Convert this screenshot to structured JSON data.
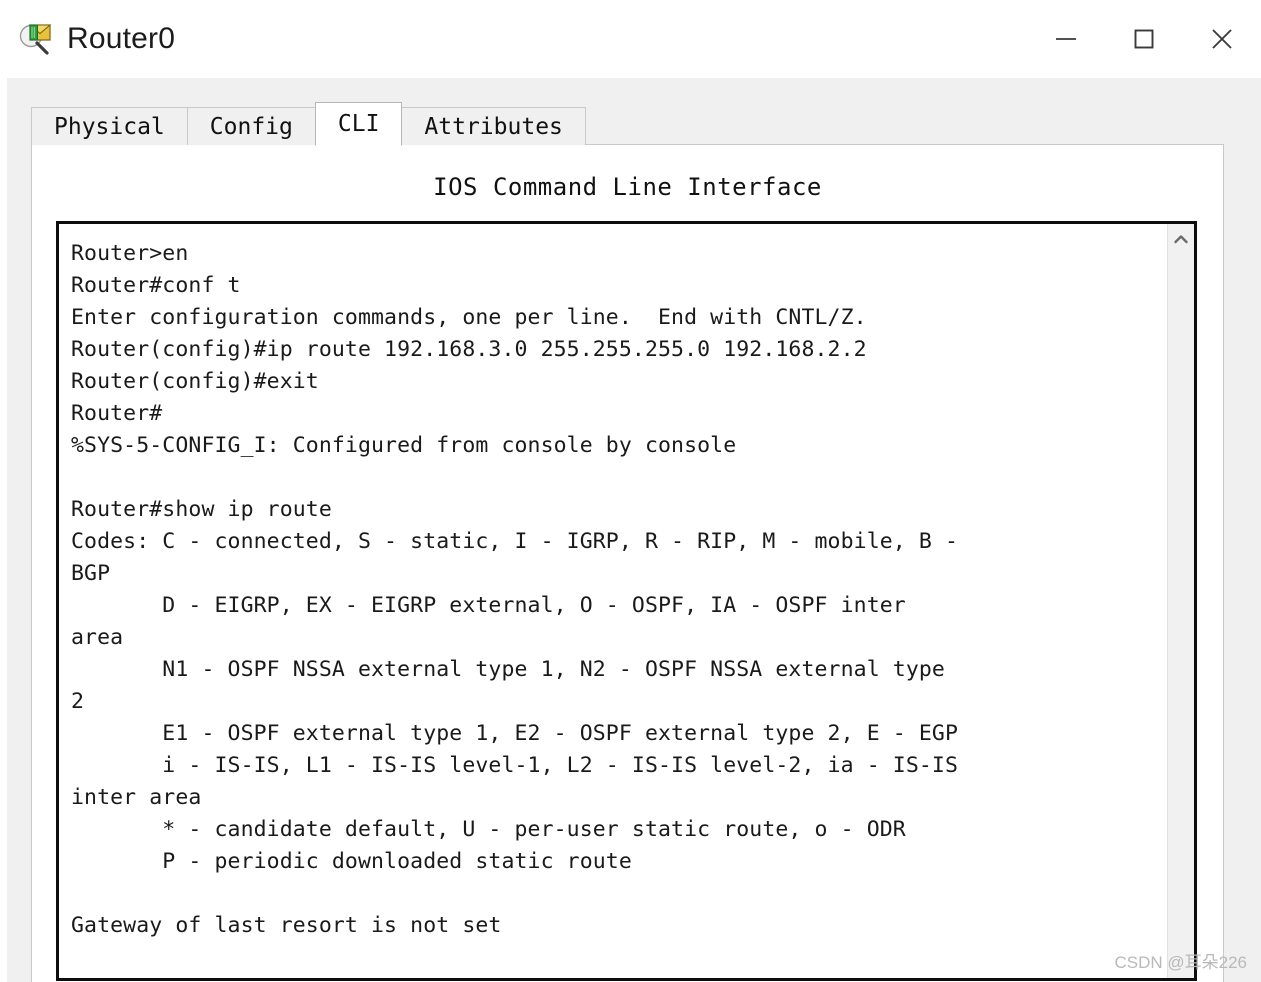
{
  "window": {
    "title": "Router0",
    "icon": "inspect-magnifier-icon",
    "controls": {
      "minimize": "minimize-icon",
      "maximize": "maximize-icon",
      "close": "close-icon"
    }
  },
  "tabs": [
    {
      "label": "Physical",
      "active": false
    },
    {
      "label": "Config",
      "active": false
    },
    {
      "label": "CLI",
      "active": true
    },
    {
      "label": "Attributes",
      "active": false
    }
  ],
  "panel": {
    "heading": "IOS Command Line Interface"
  },
  "terminal": {
    "scrollbar": {
      "up_arrow": "chevron-up-icon"
    },
    "lines": [
      "Router>en",
      "Router#conf t",
      "Enter configuration commands, one per line.  End with CNTL/Z.",
      "Router(config)#ip route 192.168.3.0 255.255.255.0 192.168.2.2",
      "Router(config)#exit",
      "Router#",
      "%SYS-5-CONFIG_I: Configured from console by console",
      "",
      "Router#show ip route",
      "Codes: C - connected, S - static, I - IGRP, R - RIP, M - mobile, B -",
      "BGP",
      "       D - EIGRP, EX - EIGRP external, O - OSPF, IA - OSPF inter",
      "area",
      "       N1 - OSPF NSSA external type 1, N2 - OSPF NSSA external type",
      "2",
      "       E1 - OSPF external type 1, E2 - OSPF external type 2, E - EGP",
      "       i - IS-IS, L1 - IS-IS level-1, L2 - IS-IS level-2, ia - IS-IS",
      "inter area",
      "       * - candidate default, U - per-user static route, o - ODR",
      "       P - periodic downloaded static route",
      "",
      "Gateway of last resort is not set"
    ]
  },
  "watermark": {
    "text": "CSDN @耳朵226"
  }
}
